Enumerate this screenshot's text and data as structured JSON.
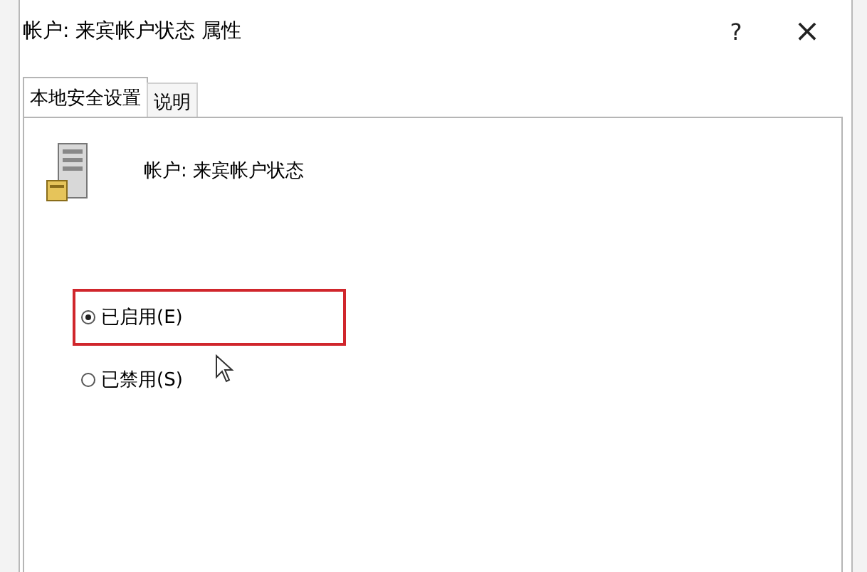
{
  "window": {
    "title": "帐户: 来宾帐户状态 属性",
    "help_button": "?",
    "close_button": "×"
  },
  "tabs": [
    {
      "label": "本地安全设置",
      "selected": true
    },
    {
      "label": "说明",
      "selected": false
    }
  ],
  "setting": {
    "label": "帐户: 来宾帐户状态"
  },
  "options": [
    {
      "label": "已启用(E)",
      "selected": true,
      "highlighted": true
    },
    {
      "label": "已禁用(S)",
      "selected": false,
      "highlighted": false
    }
  ]
}
